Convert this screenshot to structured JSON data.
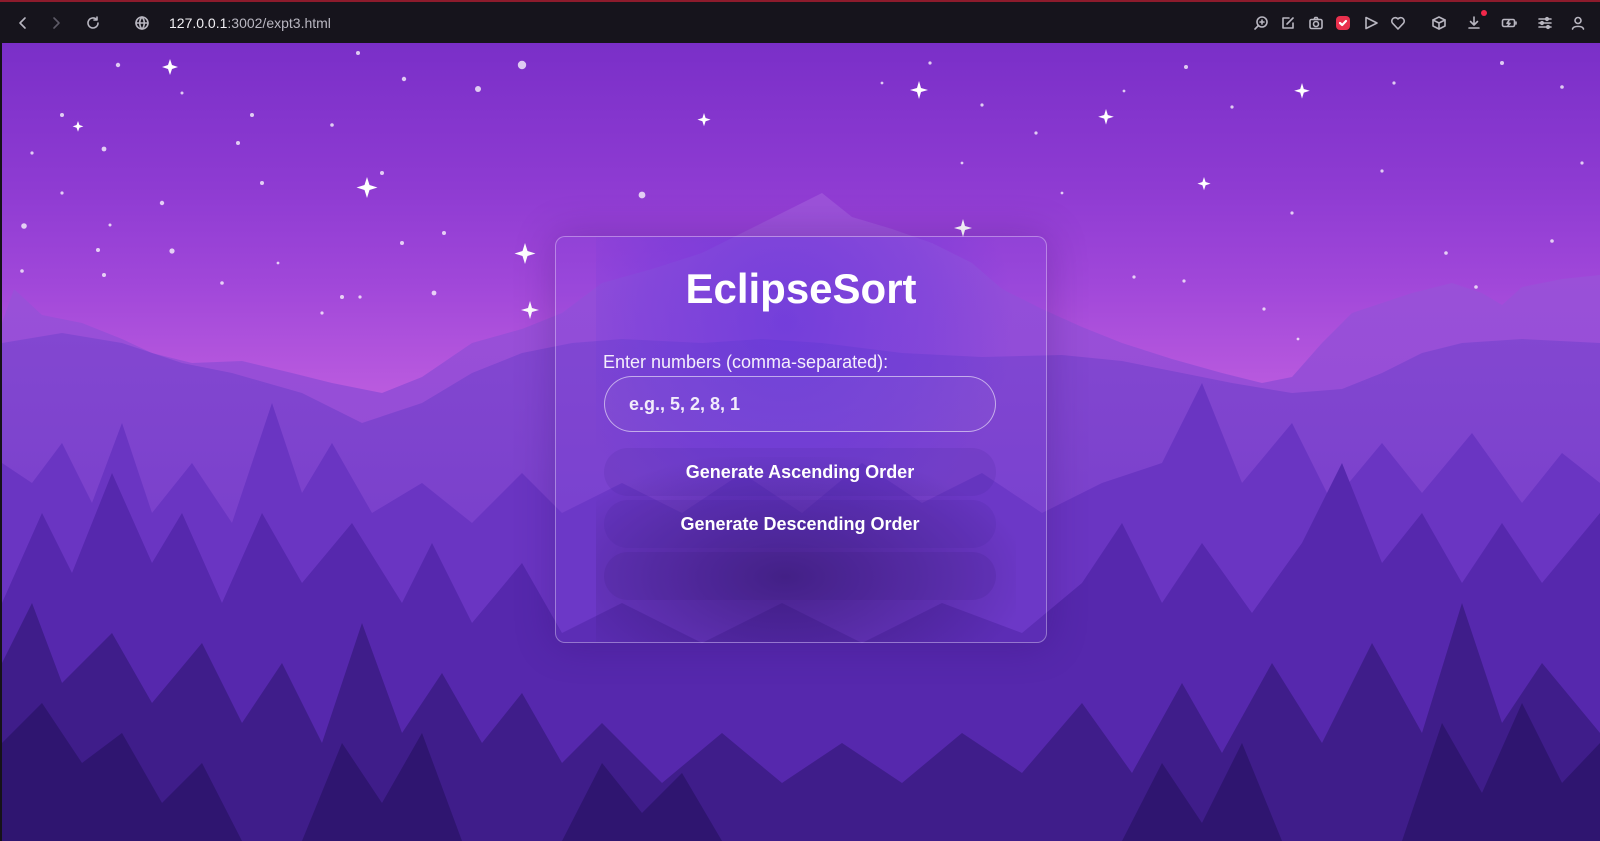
{
  "browser": {
    "url_host": "127.0.0.1",
    "url_path": ":3002/expt3.html",
    "toolbar_icons": [
      "back-icon",
      "forward-icon",
      "reload-icon",
      "site-info-icon",
      "zoom-icon",
      "edit-icon",
      "camera-icon",
      "shield-ext-icon",
      "send-icon",
      "heart-icon",
      "box-icon",
      "download-icon",
      "battery-icon",
      "settings-icon",
      "profile-icon"
    ]
  },
  "app": {
    "title": "EclipseSort",
    "input_label": "Enter numbers (comma-separated):",
    "input_placeholder": "e.g., 5, 2, 8, 1",
    "input_value": "",
    "ascending_button": "Generate Ascending Order",
    "descending_button": "Generate Descending Order",
    "result_text": ""
  },
  "colors": {
    "sky_top": "#7a2fc8",
    "sky_horizon": "#c261e0",
    "mountain_far": "#9a52d8",
    "mountain_mid": "#8043cf",
    "trees_back": "#6a35c2",
    "trees_mid": "#5528ab",
    "trees_front": "#3d1b86",
    "toolbar_bg": "#16141c"
  }
}
